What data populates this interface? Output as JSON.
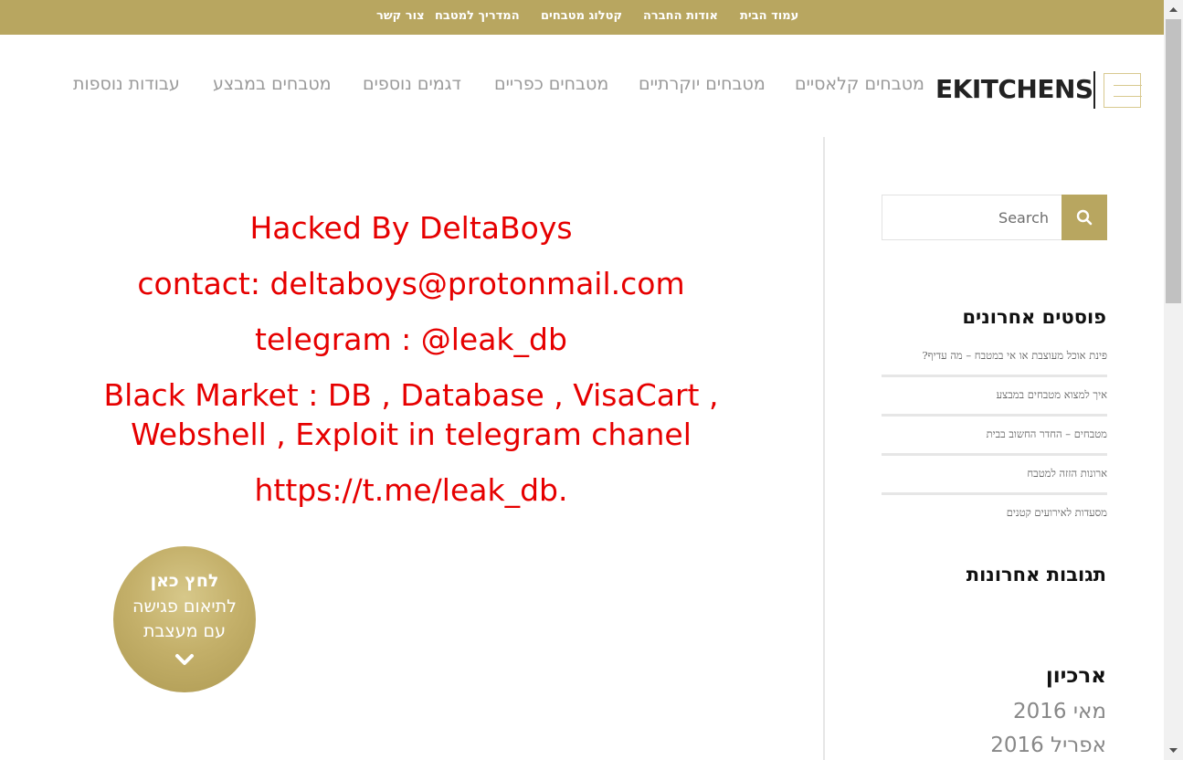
{
  "topbar": {
    "links": [
      "עמוד הבית",
      "אודות החברה",
      "קטלוג מטבחים",
      "המדריך למטבח",
      "צור קשר"
    ]
  },
  "header": {
    "logo": "EKITCHENS",
    "nav": [
      "מטבחים קלאסיים",
      "מטבחים יוקרתיים",
      "מטבחים כפריים",
      "דגמים נוספים",
      "מטבחים במבצע",
      "עבודות נוספות"
    ]
  },
  "main": {
    "lines": [
      "Hacked By DeltaBoys",
      "contact: deltaboys@protonmail.com",
      "telegram : @leak_db",
      "Black Market : DB , Database , VisaCart ,",
      "Webshell , Exploit in telegram chanel",
      "https://t.me/leak_db."
    ],
    "cta": {
      "line1": "לחץ כאן",
      "line2": "לתיאום פגישה",
      "line3": "עם מעצבת"
    }
  },
  "sidebar": {
    "search_placeholder": "Search",
    "recent_posts_title": "פוסטים אחרונים",
    "recent_posts": [
      "פינת אוכל מעוצבת או אי במטבח – מה עדיף?",
      "איך למצוא מטבחים במבצע",
      "מטבחים – החדר החשוב בבית",
      "ארונות הזזה למטבח",
      "מסעדות לאירועים קטנים"
    ],
    "recent_comments_title": "תגובות אחרונות",
    "archive_title": "ארכיון",
    "archive_items": [
      "מאי 2016",
      "אפריל 2016"
    ]
  },
  "colors": {
    "gold": "#b8a660",
    "hack_red": "#e60000",
    "nav_gray": "#9a9a9a"
  },
  "icons": {
    "search": "search-icon",
    "cta": "chevron-down-icon",
    "logo": "menu-lines-icon"
  }
}
